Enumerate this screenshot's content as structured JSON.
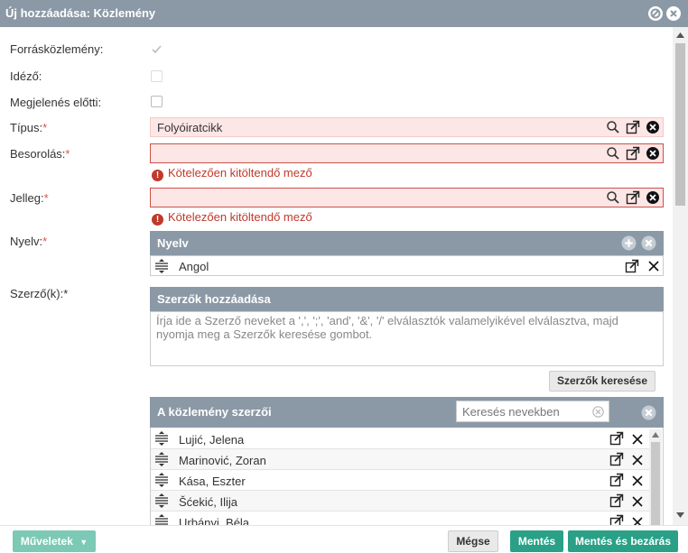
{
  "window": {
    "title": "Új hozzáadása: Közlemény"
  },
  "form": {
    "source_label": "Forrásközlemény:",
    "cited_label": "Idéző:",
    "preview_label": "Megjelenés előtti:",
    "type_label": "Típus:",
    "type_value": "Folyóiratcikk",
    "classification_label": "Besorolás:",
    "classification_error": "Kötelezően kitöltendő mező",
    "nature_label": "Jelleg:",
    "nature_error": "Kötelezően kitöltendő mező",
    "language_label": "Nyelv:",
    "authors_label": "Szerző(k):",
    "required_mark": "*",
    "checkboxes": {
      "source_checked": true,
      "cited_checked": false,
      "preview_checked": false
    }
  },
  "language_panel": {
    "title": "Nyelv",
    "items": [
      "Angol"
    ]
  },
  "add_authors": {
    "title": "Szerzők hozzáadása",
    "placeholder": "Írja ide a Szerző neveket a ',', ';', 'and', '&', '/' elválasztók valamelyikével elválasztva, majd nyomja meg a Szerzők keresése gombot.",
    "search_button": "Szerzők keresése"
  },
  "authors_panel": {
    "title": "A közlemény szerzői",
    "search_placeholder": "Keresés nevekben",
    "rows": [
      "Lujić, Jelena",
      "Marinović, Zoran",
      "Kása, Eszter",
      "Šćekić, Ilija",
      "Urbányi, Béla"
    ]
  },
  "footer": {
    "actions_label": "Műveletek",
    "cancel_label": "Mégse",
    "save_label": "Mentés",
    "save_close_label": "Mentés és bezárás"
  },
  "colors": {
    "header": "#8b99a6",
    "accent_green": "#2aa086",
    "error": "#c0392b",
    "required_bg": "#fde6e6"
  }
}
